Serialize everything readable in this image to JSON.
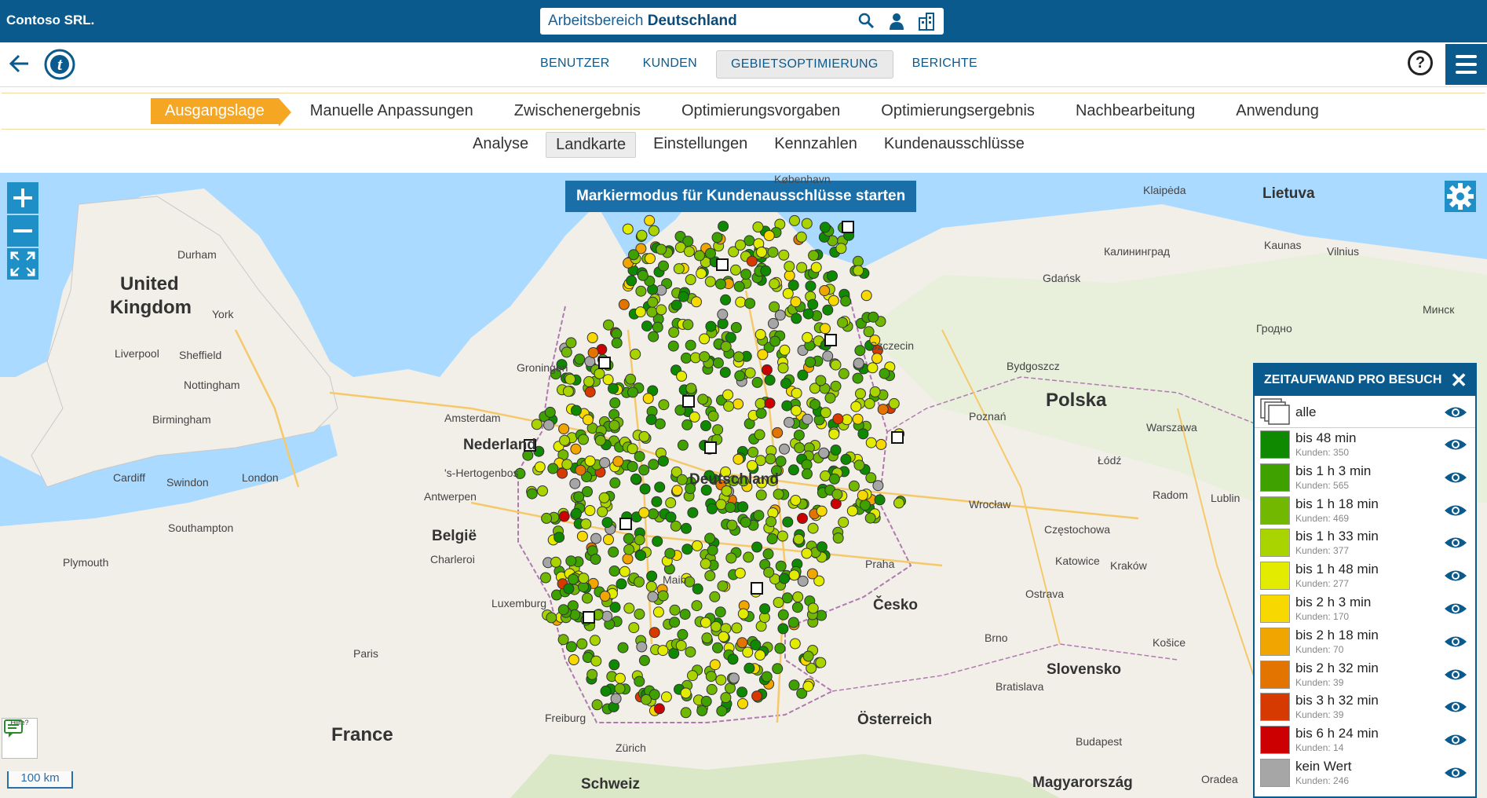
{
  "company": "Contoso SRL.",
  "workspace": {
    "prefix": "Arbeitsbereich",
    "name": "Deutschland"
  },
  "nav": {
    "tabs": [
      "BENUTZER",
      "KUNDEN",
      "GEBIETSOPTIMIERUNG",
      "BERICHTE"
    ],
    "active": "GEBIETSOPTIMIERUNG",
    "help": "?"
  },
  "steps": [
    "Ausgangslage",
    "Manuelle Anpassungen",
    "Zwischenergebnis",
    "Optimierungsvorgaben",
    "Optimierungsergebnis",
    "Nachbearbeitung",
    "Anwendung"
  ],
  "subtabs": [
    "Analyse",
    "Landkarte",
    "Einstellungen",
    "Kennzahlen",
    "Kundenausschlüsse"
  ],
  "map": {
    "mark_button": "Markiermodus für Kundenausschlüsse starten",
    "scale": "100 km",
    "hilfe": "Hilfe?",
    "labels": {
      "united_kingdom_1": "United",
      "united_kingdom_2": "Kingdom",
      "nederland": "Nederland",
      "belgie": "België",
      "france": "France",
      "polska": "Polska",
      "cesko": "Česko",
      "osterreich": "Österreich",
      "slovensko": "Slovensko",
      "schweiz": "Schweiz",
      "lietuva": "Lietuva",
      "magyarorszag": "Magyarország",
      "deutschland": "Deutschland",
      "durham": "Durham",
      "york": "York",
      "liverpool": "Liverpool",
      "sheffield": "Sheffield",
      "nottingham": "Nottingham",
      "birmingham": "Birmingham",
      "cardiff": "Cardiff",
      "swindon": "Swindon",
      "london": "London",
      "southampton": "Southampton",
      "plymouth": "Plymouth",
      "amsterdam": "Amsterdam",
      "groningen": "Groningen",
      "hertogenbosch": "'s-Hertogenbos",
      "antwerpen": "Antwerpen",
      "charleroi": "Charleroi",
      "luxemburg": "Luxemburg",
      "paris": "Paris",
      "freiburg": "Freiburg",
      "zurich": "Zürich",
      "main": "Main",
      "kobenhavn": "København",
      "klaipeda": "Klaipėda",
      "kaliningrad": "Калининград",
      "gdansk": "Gdańsk",
      "kaunas": "Kaunas",
      "vilnius": "Vilnius",
      "minsk": "Минск",
      "grodno": "Гродно",
      "szczecin": "Szczecin",
      "bydgoszcz": "Bydgoszcz",
      "poznan": "Poznań",
      "warszawa": "Warszawa",
      "lodz": "Łódź",
      "wroclaw": "Wrocław",
      "radom": "Radom",
      "lublin": "Lublin",
      "czestochowa": "Częstochowa",
      "katowice": "Katowice",
      "krakow": "Kraków",
      "ostrava": "Ostrava",
      "praha": "Praha",
      "brno": "Brno",
      "kosice": "Košice",
      "bratislava": "Bratislava",
      "budapest": "Budapest",
      "oradea": "Oradea"
    }
  },
  "legend": {
    "title": "ZEITAUFWAND PRO BESUCH",
    "close": "✕",
    "all_label": "alle",
    "items": [
      {
        "label": "bis 48 min",
        "count": "Kunden: 350",
        "color": "#0f8a00"
      },
      {
        "label": "bis 1 h 3 min",
        "count": "Kunden: 565",
        "color": "#3ea100"
      },
      {
        "label": "bis 1 h 18 min",
        "count": "Kunden: 469",
        "color": "#72b800"
      },
      {
        "label": "bis 1 h 33 min",
        "count": "Kunden: 377",
        "color": "#aad400"
      },
      {
        "label": "bis 1 h 48 min",
        "count": "Kunden: 277",
        "color": "#e3ec00"
      },
      {
        "label": "bis 2 h 3 min",
        "count": "Kunden: 170",
        "color": "#f7d800"
      },
      {
        "label": "bis 2 h 18 min",
        "count": "Kunden: 70",
        "color": "#f0a500"
      },
      {
        "label": "bis 2 h 32 min",
        "count": "Kunden: 39",
        "color": "#e47400"
      },
      {
        "label": "bis 3 h 32 min",
        "count": "Kunden: 39",
        "color": "#d63a00"
      },
      {
        "label": "bis 6 h 24 min",
        "count": "Kunden: 14",
        "color": "#cc0000"
      },
      {
        "label": "kein Wert",
        "count": "Kunden: 246",
        "color": "#a6a6a6"
      }
    ]
  },
  "colors": {
    "primary": "#0b5a8e",
    "accent": "#f5a623",
    "map_button": "#1f8fc7"
  }
}
